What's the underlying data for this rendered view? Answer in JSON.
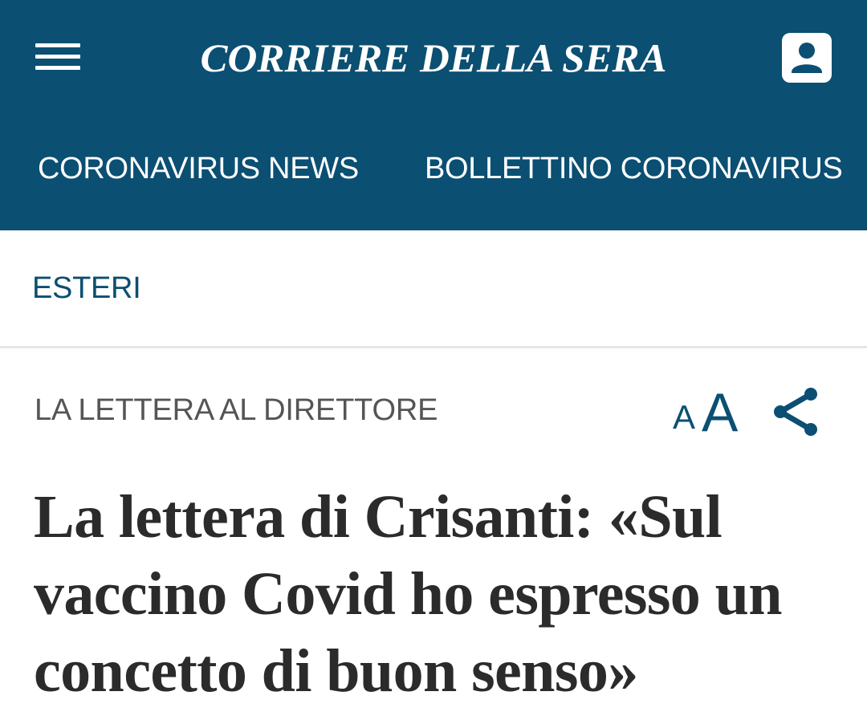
{
  "header": {
    "logo_text": "CORRIERE DELLA SERA",
    "menu_icon": "hamburger-menu-icon",
    "account_icon": "user-account-icon",
    "background_color": "#0b4f72"
  },
  "nav": {
    "items": [
      {
        "label": "CORONAVIRUS NEWS"
      },
      {
        "label": "BOLLETTINO CORONAVIRUS"
      }
    ]
  },
  "section": {
    "label": "ESTERI",
    "color": "#0b4f72"
  },
  "article": {
    "kicker": "LA LETTERA AL DIRETTORE",
    "font_size_small": "A",
    "font_size_big": "A",
    "share_icon": "share-icon",
    "headline": "La lettera di Crisanti: «Sul vaccino Covid ho espresso un concetto di buon senso»"
  }
}
